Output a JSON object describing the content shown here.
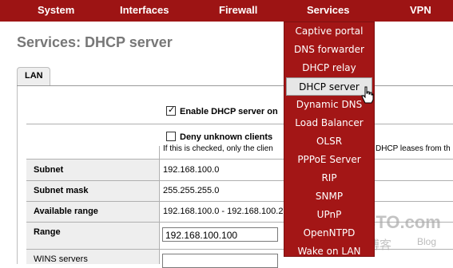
{
  "menu": {
    "system": "System",
    "interfaces": "Interfaces",
    "firewall": "Firewall",
    "services": "Services",
    "vpn": "VPN"
  },
  "page_title": "Services: DHCP server",
  "tabs": [
    {
      "label": "LAN",
      "active": true
    }
  ],
  "form": {
    "enable": {
      "label": "Enable DHCP server on",
      "checked": true
    },
    "deny": {
      "label": "Deny unknown clients",
      "checked": false,
      "note_left": "If this is checked, only the clien",
      "note_right": "DHCP leases from th"
    },
    "subnet": {
      "label": "Subnet",
      "value": "192.168.100.0"
    },
    "subnet_mask": {
      "label": "Subnet mask",
      "value": "255.255.255.0"
    },
    "available_range": {
      "label": "Available range",
      "value": "192.168.100.0 - 192.168.100.2"
    },
    "range": {
      "label": "Range",
      "value": "192.168.100.100"
    },
    "wins": {
      "label": "WINS servers",
      "value": ""
    }
  },
  "services_dropdown": {
    "items": [
      "Captive portal",
      "DNS forwarder",
      "DHCP relay",
      "DHCP server",
      "Dynamic DNS",
      "Load Balancer",
      "OLSR",
      "PPPoE Server",
      "RIP",
      "SNMP",
      "UPnP",
      "OpenNTPD",
      "Wake on LAN"
    ],
    "selected": "DHCP server"
  },
  "watermark": {
    "main": "51CTO.com",
    "cn": "技术博客",
    "blog": "Blog"
  },
  "colors": {
    "menu_bg": "#9d1414",
    "dropdown_bg": "#a31616",
    "label_bg": "#eeeeee",
    "title": "#777777"
  }
}
